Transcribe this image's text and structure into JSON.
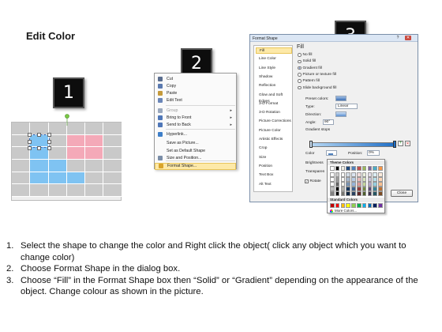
{
  "title": "Edit Color",
  "steps": [
    "1",
    "2",
    "3"
  ],
  "context_menu": {
    "items": [
      {
        "label": "Cut",
        "icon": "scissors-icon",
        "color": "#5b6e8f"
      },
      {
        "label": "Copy",
        "icon": "copy-icon",
        "color": "#5b7ab0"
      },
      {
        "label": "Paste",
        "icon": "paste-icon",
        "color": "#c59a3b"
      },
      {
        "label": "Edit Text",
        "icon": "edit-text-icon",
        "color": "#6a86b8"
      },
      {
        "label": "Group",
        "icon": "group-icon",
        "color": "#9aa8bd",
        "submenu": true,
        "disabled": true
      },
      {
        "label": "Bring to Front",
        "icon": "bring-front-icon",
        "color": "#4f77b8",
        "submenu": true
      },
      {
        "label": "Send to Back",
        "icon": "send-back-icon",
        "color": "#4f77b8",
        "submenu": true
      },
      {
        "label": "Hyperlink...",
        "icon": "hyperlink-icon",
        "color": "#3e7fc9"
      },
      {
        "label": "Save as Picture...",
        "icon": "",
        "color": ""
      },
      {
        "label": "Set as Default Shape",
        "icon": "",
        "color": ""
      },
      {
        "label": "Size and Position...",
        "icon": "size-icon",
        "color": "#7b8ea8"
      },
      {
        "label": "Format Shape...",
        "icon": "format-shape-icon",
        "color": "#d9a42b",
        "highlighted": true
      }
    ]
  },
  "dialog": {
    "title": "Format Shape",
    "nav_items": [
      "Fill",
      "Line Color",
      "Line Style",
      "Shadow",
      "Reflection",
      "Glow and Soft Edges",
      "3-D Format",
      "3-D Rotation",
      "Picture Corrections",
      "Picture Color",
      "Artistic Effects",
      "Crop",
      "Size",
      "Position",
      "Text Box",
      "Alt Text"
    ],
    "selected_nav": "Fill",
    "heading": "Fill",
    "fill_options": [
      {
        "label": "No fill",
        "selected": false
      },
      {
        "label": "Solid fill",
        "selected": false
      },
      {
        "label": "Gradient fill",
        "selected": true
      },
      {
        "label": "Picture or texture fill",
        "selected": false
      },
      {
        "label": "Pattern fill",
        "selected": false
      },
      {
        "label": "Slide background fill",
        "selected": false
      }
    ],
    "preset_colors_label": "Preset colors:",
    "type_label": "Type:",
    "type_value": "Linear",
    "direction_label": "Direction:",
    "angle_label": "Angle:",
    "angle_value": "90°",
    "gradient_stops_label": "Gradient stops",
    "color_label": "Color",
    "position_label": "Position:",
    "position_value": "0%",
    "brightness_label": "Brightness",
    "transparency_label": "Transparen",
    "rotate_label": "Rotate",
    "close_label": "Close"
  },
  "palette": {
    "theme_header": "Theme Colors",
    "standard_header": "Standard Colors",
    "more_colors": "More Colors...",
    "theme_columns": [
      "#ffffff",
      "#000000",
      "#eeece1",
      "#1f497d",
      "#4f81bd",
      "#c0504d",
      "#9bbb59",
      "#8064a2",
      "#4bacc6",
      "#f79646"
    ],
    "standard_colors": [
      "#c00000",
      "#ff0000",
      "#ffc000",
      "#ffff00",
      "#92d050",
      "#00b050",
      "#00b0f0",
      "#0070c0",
      "#002060",
      "#7030a0"
    ]
  },
  "grid_colors": {
    "gray": "#c9c9c9",
    "blue": "#7fc3f2",
    "pink": "#f4a9b8"
  },
  "instructions": [
    {
      "num": "1.",
      "text": "Select the shape to change the color and Right click the object( click any object which you want to change color)"
    },
    {
      "num": "2.",
      "text": "Choose Format Shape in the dialog box."
    },
    {
      "num": "3.",
      "text": "Choose “Fill” in the Format Shape box then “Solid” or “Gradient” depending on the appearance of the object. Change colour as shown in the picture."
    }
  ]
}
